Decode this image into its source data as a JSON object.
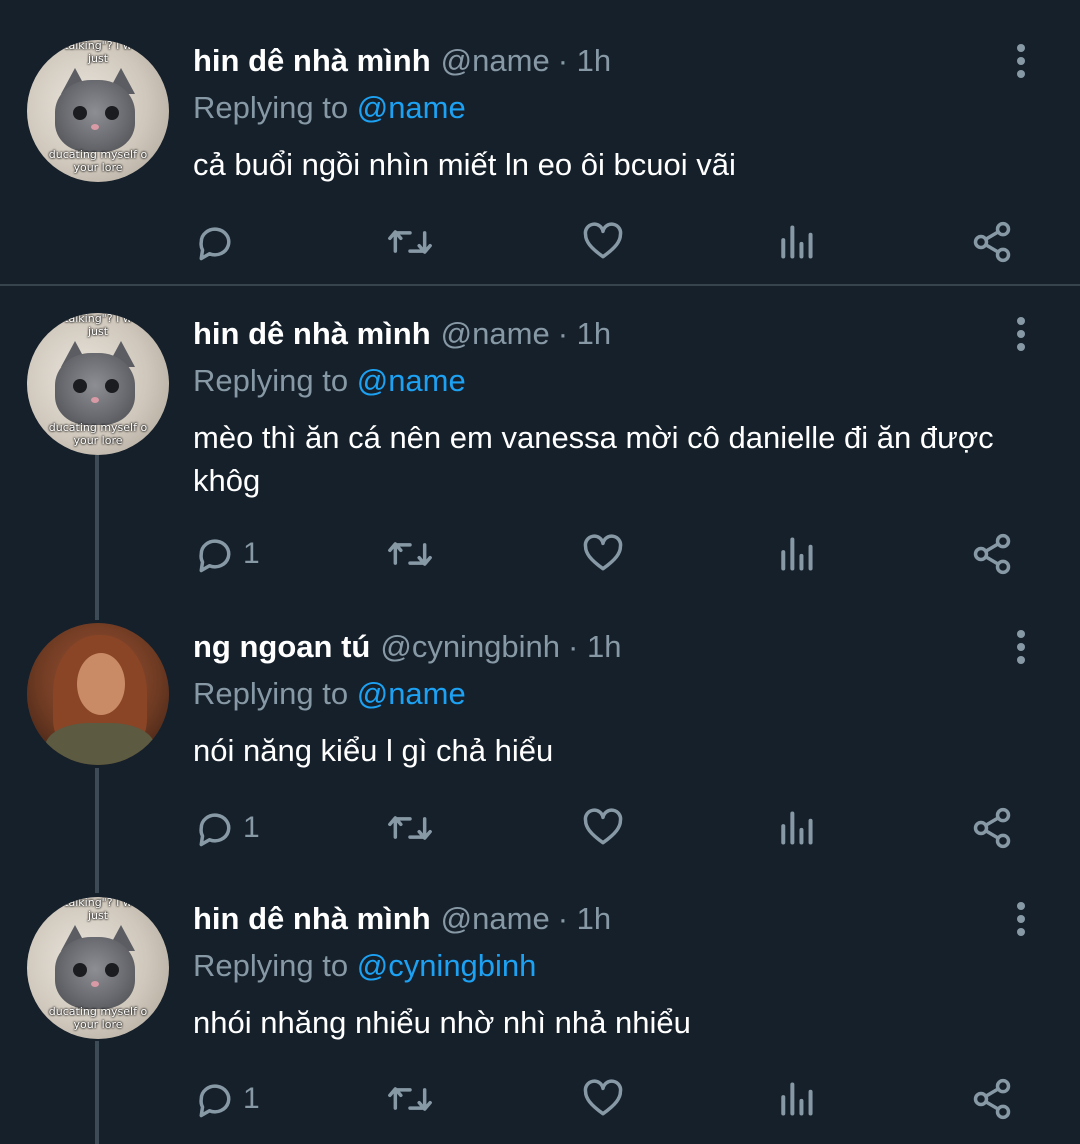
{
  "tweets": [
    {
      "display_name": "hin dê nhà mình",
      "handle": "@name",
      "time": "· 1h",
      "replying_prefix": "Replying to",
      "replying_to": "@name",
      "text": "cả buổi ngồi nhìn miết ln eo ôi bcuoi vãi",
      "reply_count": "",
      "avatar": "cat",
      "avatar_text_top": "talking\"? I w",
      "avatar_text_top2": "just",
      "avatar_text_bottom": "ducating myself o",
      "avatar_text_bottom2": "your lore"
    },
    {
      "display_name": "hin dê nhà mình",
      "handle": "@name",
      "time": "· 1h",
      "replying_prefix": "Replying to",
      "replying_to": "@name",
      "text": "mèo thì ăn cá nên em vanessa mời cô danielle đi ăn được khôg",
      "reply_count": "1",
      "avatar": "cat",
      "avatar_text_top": "talking\"? I w",
      "avatar_text_top2": "just",
      "avatar_text_bottom": "ducating myself o",
      "avatar_text_bottom2": "your lore"
    },
    {
      "display_name": "ng ngoan tú",
      "handle": "@cyningbinh",
      "time": "· 1h",
      "replying_prefix": "Replying to",
      "replying_to": "@name",
      "text": "nói năng kiểu l gì chả hiểu",
      "reply_count": "1",
      "avatar": "girl"
    },
    {
      "display_name": "hin dê nhà mình",
      "handle": "@name",
      "time": "· 1h",
      "replying_prefix": "Replying to",
      "replying_to": "@cyningbinh",
      "text": "nhói nhăng nhiểu nhờ nhì nhả nhiểu",
      "reply_count": "1",
      "avatar": "cat",
      "avatar_text_top": "talking\"? I w",
      "avatar_text_top2": "just",
      "avatar_text_bottom": "ducating myself o",
      "avatar_text_bottom2": "your lore"
    }
  ],
  "icons": {
    "reply": "reply-icon",
    "retweet": "retweet-icon",
    "like": "heart-icon",
    "analytics": "analytics-icon",
    "share": "share-icon",
    "more": "more-vertical-icon"
  },
  "colors": {
    "background": "#15202b",
    "secondary_text": "#8899a6",
    "link": "#1da1f2",
    "divider": "#38444d"
  }
}
